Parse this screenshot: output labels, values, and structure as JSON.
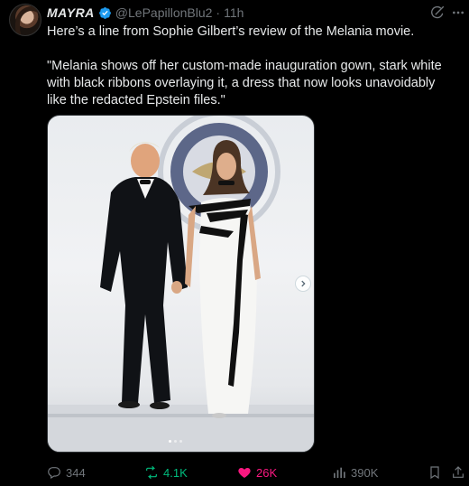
{
  "author": {
    "display_name": "MAYRA",
    "handle": "@LePapillonBlu2",
    "separator": "·",
    "time": "11h"
  },
  "tweet": {
    "line1": "Here’s a line from Sophie Gilbert’s review of the Melania movie.",
    "line2": "\"Melania shows off her custom-made inauguration gown, stark white with black ribbons overlaying it, a dress that now looks unavoidably like the redacted Epstein files.\""
  },
  "media": {
    "image": "photo-couple-inauguration-ball",
    "carousel_dots": 3,
    "active_dot": 0
  },
  "actions": {
    "replies": "344",
    "reposts": "4.1K",
    "likes": "26K",
    "views": "390K"
  },
  "icons": [
    "verified-icon",
    "grok-icon",
    "more-icon",
    "reply-icon",
    "repost-icon",
    "like-icon",
    "views-icon",
    "bookmark-icon",
    "share-icon",
    "chevron-right-icon"
  ],
  "colors": {
    "background": "#000000",
    "text": "#e7e9ea",
    "secondary": "#71767b",
    "verified": "#1d9bf0",
    "repost": "#00ba7c",
    "like": "#f91880"
  }
}
